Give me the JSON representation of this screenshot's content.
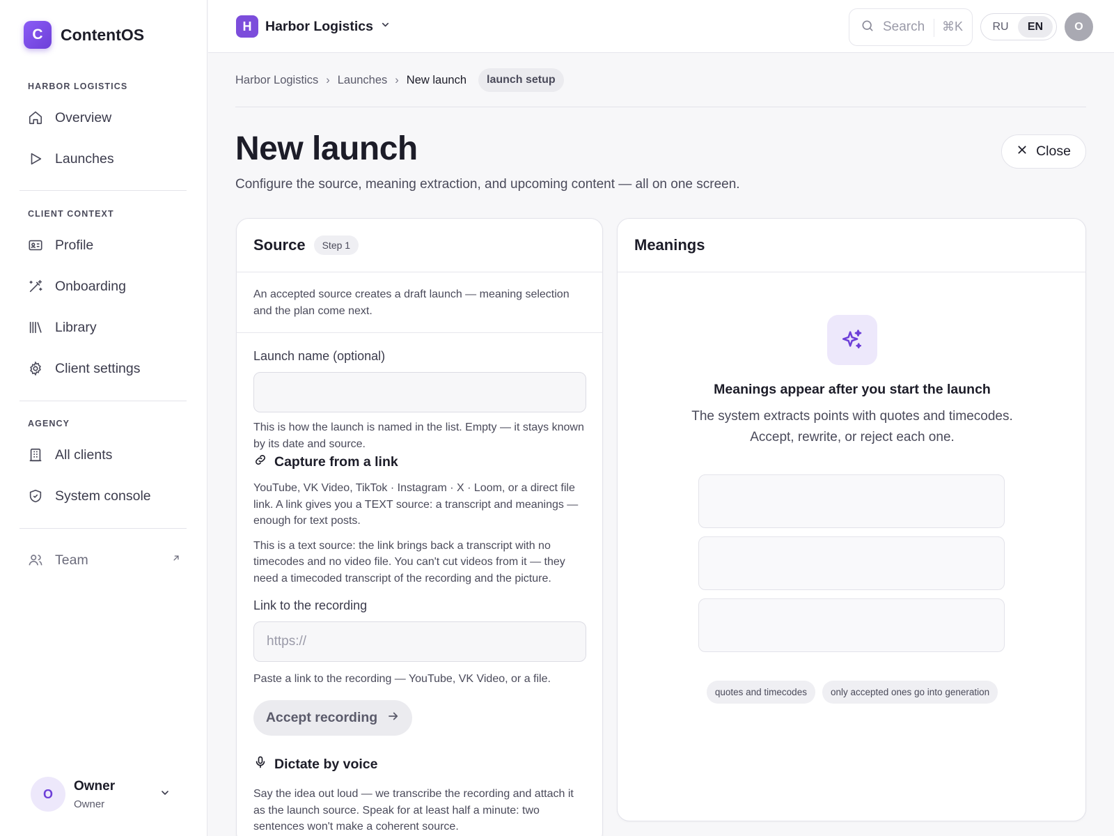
{
  "brand": {
    "logo_letter": "C",
    "name": "ContentOS"
  },
  "sidebar": {
    "sections": [
      {
        "label": "HARBOR LOGISTICS"
      },
      {
        "label": "CLIENT CONTEXT"
      },
      {
        "label": "AGENCY"
      }
    ],
    "items": [
      {
        "label": "Overview",
        "icon": "home-icon"
      },
      {
        "label": "Launches",
        "icon": "play-icon"
      },
      {
        "label": "Profile",
        "icon": "id-card-icon"
      },
      {
        "label": "Onboarding",
        "icon": "magic-wand-icon"
      },
      {
        "label": "Library",
        "icon": "library-icon"
      },
      {
        "label": "Client settings",
        "icon": "gear-icon"
      },
      {
        "label": "All clients",
        "icon": "building-icon"
      },
      {
        "label": "System console",
        "icon": "shield-icon"
      },
      {
        "label": "Team",
        "icon": "users-icon",
        "external": true
      }
    ],
    "user": {
      "initial": "O",
      "name": "Owner",
      "role": "Owner"
    }
  },
  "topbar": {
    "workspace": {
      "initial": "H",
      "name": "Harbor Logistics"
    },
    "search": {
      "placeholder": "Search",
      "shortcut": "⌘K"
    },
    "languages": [
      "RU",
      "EN"
    ],
    "active_language": "EN",
    "avatar_initial": "O"
  },
  "breadcrumb": {
    "items": [
      "Harbor Logistics",
      "Launches",
      "New launch"
    ],
    "separator": "›",
    "badge": "launch setup"
  },
  "page": {
    "title": "New launch",
    "subtitle": "Configure the source, meaning extraction, and upcoming content — all on one screen.",
    "close_label": "Close"
  },
  "source": {
    "title": "Source",
    "step": "Step 1",
    "intro": "An accepted source creates a draft launch — meaning selection and the plan come next.",
    "name_label": "Launch name (optional)",
    "name_value": "",
    "name_hint": "This is how the launch is named in the list. Empty — it stays known by its date and source.",
    "capture_title": "Capture from a link",
    "capture_desc": "YouTube, VK Video, TikTok · Instagram · X · Loom, or a direct file link. A link gives you a TEXT source: a transcript and meanings — enough for text posts.",
    "capture_note": "This is a text source: the link brings back a transcript with no timecodes and no video file. You can't cut videos from it — they need a timecoded transcript of the recording and the picture.",
    "link_label": "Link to the recording",
    "link_placeholder": "https://",
    "link_hint": "Paste a link to the recording — YouTube, VK Video, or a file.",
    "accept_label": "Accept recording",
    "voice_title": "Dictate by voice",
    "voice_desc": "Say the idea out loud — we transcribe the recording and attach it as the launch source. Speak for at least half a minute: two sentences won't make a coherent source."
  },
  "meanings": {
    "title": "Meanings",
    "empty_title": "Meanings appear after you start the launch",
    "empty_line1": "The system extracts points with quotes and timecodes.",
    "empty_line2": "Accept, rewrite, or reject each one.",
    "chips": [
      "quotes and timecodes",
      "only accepted ones go into generation"
    ]
  },
  "colors": {
    "accent": "#7c4ddb",
    "accent_soft": "#ede8fb",
    "muted_bg": "#ebebef"
  }
}
